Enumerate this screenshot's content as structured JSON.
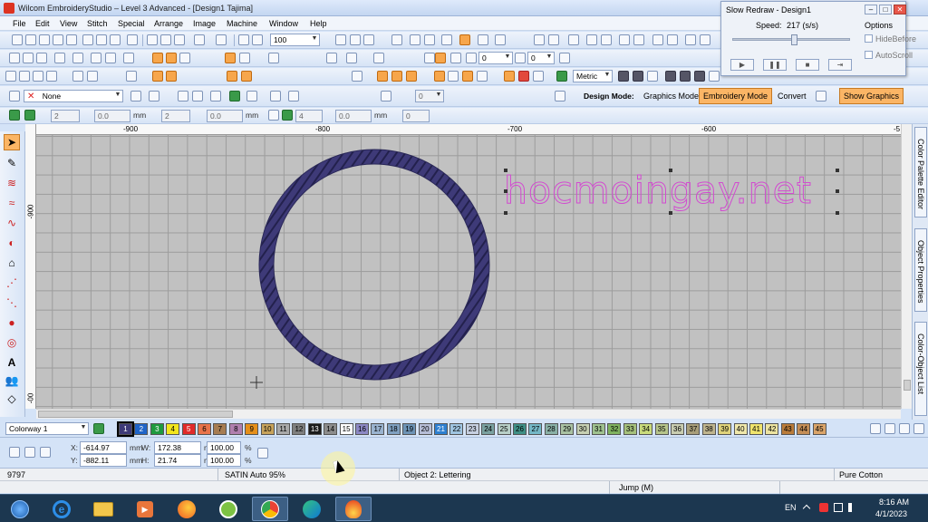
{
  "window": {
    "title": "Wilcom EmbroideryStudio – Level 3 Advanced - [Design1       Tajima]"
  },
  "menu": [
    "File",
    "Edit",
    "View",
    "Stitch",
    "Special",
    "Arrange",
    "Image",
    "Machine",
    "Window",
    "Help"
  ],
  "toolbar1": {
    "zoom": "100"
  },
  "toolbar2": {
    "stitch_value": "0",
    "stitch_value2": "0"
  },
  "toolbar3": {
    "style_value": "None",
    "units": "Metric",
    "field1": "0"
  },
  "design_mode": {
    "label": "Design Mode:",
    "graphics_mode": "Graphics Mode",
    "embroidery_mode": "Embroidery Mode",
    "convert": "Convert",
    "show_graphics": "Show Graphics"
  },
  "toolbar4": {
    "f1": "2",
    "f2": "0.0",
    "f3": "2",
    "f4": "0.0",
    "f5": "4",
    "f6": "0.0",
    "f7": "0",
    "unit": "mm"
  },
  "rulers": {
    "h_labels": [
      "-900",
      "-800",
      "-700",
      "-600",
      "-5"
    ],
    "v_labels": [
      "-900",
      "-00"
    ]
  },
  "canvas": {
    "lettering_text": "hocmoingay.net",
    "accent_purple": "#3e3a78",
    "lettering_color": "#d24bd0"
  },
  "right_tabs": [
    "Color Palette Editor",
    "Object Properties",
    "Color-Object List"
  ],
  "colorway": {
    "name": "Colorway 1"
  },
  "swatches": [
    {
      "n": "1",
      "c": "#3e3a78",
      "t": "#ffffff"
    },
    {
      "n": "2",
      "c": "#1f64c8",
      "t": "#ffffff"
    },
    {
      "n": "3",
      "c": "#1f9a3f",
      "t": "#ffffff"
    },
    {
      "n": "4",
      "c": "#f2e51d",
      "t": "#000000"
    },
    {
      "n": "5",
      "c": "#e02a2a",
      "t": "#ffffff"
    },
    {
      "n": "6",
      "c": "#e8734a",
      "t": "#000000"
    },
    {
      "n": "7",
      "c": "#a67c52",
      "t": "#000000"
    },
    {
      "n": "8",
      "c": "#b07fae",
      "t": "#000000"
    },
    {
      "n": "9",
      "c": "#e58f1a",
      "t": "#000000"
    },
    {
      "n": "10",
      "c": "#c7a25a",
      "t": "#000000"
    },
    {
      "n": "11",
      "c": "#a8a8a8",
      "t": "#000000"
    },
    {
      "n": "12",
      "c": "#7e7e7e",
      "t": "#000000"
    },
    {
      "n": "13",
      "c": "#1a1a1a",
      "t": "#ffffff"
    },
    {
      "n": "14",
      "c": "#8c8c8c",
      "t": "#000000"
    },
    {
      "n": "15",
      "c": "#ffffff",
      "t": "#000000"
    },
    {
      "n": "16",
      "c": "#8c88c4",
      "t": "#000000"
    },
    {
      "n": "17",
      "c": "#9ab3cf",
      "t": "#000000"
    },
    {
      "n": "18",
      "c": "#7fa0c0",
      "t": "#000000"
    },
    {
      "n": "19",
      "c": "#6d93b5",
      "t": "#000000"
    },
    {
      "n": "20",
      "c": "#b6bdd6",
      "t": "#000000"
    },
    {
      "n": "21",
      "c": "#2d7fd0",
      "t": "#ffffff"
    },
    {
      "n": "22",
      "c": "#9fc4e0",
      "t": "#000000"
    },
    {
      "n": "23",
      "c": "#c6cfe0",
      "t": "#000000"
    },
    {
      "n": "24",
      "c": "#7aa1a0",
      "t": "#000000"
    },
    {
      "n": "25",
      "c": "#b8cfc7",
      "t": "#000000"
    },
    {
      "n": "26",
      "c": "#3f8f85",
      "t": "#000000"
    },
    {
      "n": "27",
      "c": "#74b7c6",
      "t": "#000000"
    },
    {
      "n": "28",
      "c": "#89b0a6",
      "t": "#000000"
    },
    {
      "n": "29",
      "c": "#a9c1a2",
      "t": "#000000"
    },
    {
      "n": "30",
      "c": "#c6cfb2",
      "t": "#000000"
    },
    {
      "n": "31",
      "c": "#9fc28f",
      "t": "#000000"
    },
    {
      "n": "32",
      "c": "#7fb25f",
      "t": "#000000"
    },
    {
      "n": "33",
      "c": "#a5c07b",
      "t": "#000000"
    },
    {
      "n": "34",
      "c": "#c9da7b",
      "t": "#000000"
    },
    {
      "n": "35",
      "c": "#b6c48a",
      "t": "#000000"
    },
    {
      "n": "36",
      "c": "#c8ccb0",
      "t": "#000000"
    },
    {
      "n": "37",
      "c": "#a89e7a",
      "t": "#000000"
    },
    {
      "n": "38",
      "c": "#bfb48d",
      "t": "#000000"
    },
    {
      "n": "39",
      "c": "#dfd27a",
      "t": "#000000"
    },
    {
      "n": "40",
      "c": "#efe7a9",
      "t": "#000000"
    },
    {
      "n": "41",
      "c": "#efe36c",
      "t": "#000000"
    },
    {
      "n": "42",
      "c": "#ece3a0",
      "t": "#000000"
    },
    {
      "n": "43",
      "c": "#b97b3a",
      "t": "#000000"
    },
    {
      "n": "44",
      "c": "#c38d56",
      "t": "#000000"
    },
    {
      "n": "45",
      "c": "#d9a368",
      "t": "#000000"
    }
  ],
  "coords": {
    "x_label": "X:",
    "x": "-614.97",
    "y_label": "Y:",
    "y": "-882.11",
    "w_label": "W:",
    "w": "172.38",
    "h_label": "H:",
    "h": "21.74",
    "unit": "mm",
    "pct1": "100.00",
    "pct2": "100.00",
    "pct_sign": "%"
  },
  "status": {
    "stitches": "9797",
    "stitch_type": "SATIN Auto 95%",
    "object": "Object 2: Lettering",
    "fabric": "Pure Cotton",
    "jump": "Jump (M)"
  },
  "slow_redraw": {
    "title": "Slow Redraw - Design1",
    "speed_label": "Speed:",
    "speed_value": "217 (s/s)",
    "options": "Options",
    "hide_before": "HideBefore",
    "auto_scroll": "AutoScroll",
    "speed_fraction": 0.52
  },
  "taskbar": {
    "lang": "EN",
    "time": "8:16 AM",
    "date": "4/1/2023"
  }
}
